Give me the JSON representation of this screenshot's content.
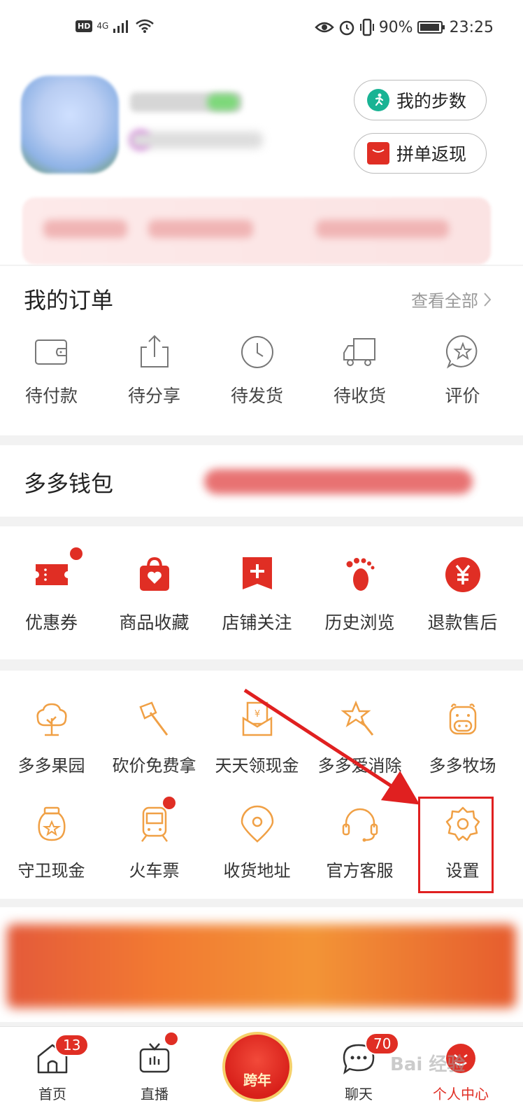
{
  "status_bar": {
    "hd": "HD",
    "net": "4G",
    "battery": "90%",
    "time": "23:25"
  },
  "header": {
    "steps_label": "我的步数",
    "group_label": "拼单返现"
  },
  "orders": {
    "title": "我的订单",
    "view_all": "查看全部",
    "items": [
      {
        "label": "待付款",
        "icon": "wallet-icon"
      },
      {
        "label": "待分享",
        "icon": "share-icon"
      },
      {
        "label": "待发货",
        "icon": "clock-icon"
      },
      {
        "label": "待收货",
        "icon": "truck-icon"
      },
      {
        "label": "评价",
        "icon": "star-bubble-icon"
      }
    ]
  },
  "wallet": {
    "title": "多多钱包"
  },
  "services": [
    {
      "label": "优惠券",
      "icon": "coupon-icon"
    },
    {
      "label": "商品收藏",
      "icon": "favorite-bag-icon"
    },
    {
      "label": "店铺关注",
      "icon": "store-follow-icon"
    },
    {
      "label": "历史浏览",
      "icon": "footprint-icon"
    },
    {
      "label": "退款售后",
      "icon": "refund-icon"
    }
  ],
  "tools_row1": [
    {
      "label": "多多果园",
      "icon": "tree-icon"
    },
    {
      "label": "砍价免费拿",
      "icon": "axe-icon"
    },
    {
      "label": "天天领现金",
      "icon": "cash-envelope-icon"
    },
    {
      "label": "多多爱消除",
      "icon": "star-wand-icon"
    },
    {
      "label": "多多牧场",
      "icon": "cow-icon"
    }
  ],
  "tools_row2": [
    {
      "label": "守卫现金",
      "icon": "cash-jar-icon"
    },
    {
      "label": "火车票",
      "icon": "train-icon"
    },
    {
      "label": "收货地址",
      "icon": "location-icon"
    },
    {
      "label": "官方客服",
      "icon": "headset-icon"
    },
    {
      "label": "设置",
      "icon": "gear-icon"
    }
  ],
  "tabbar": {
    "home": {
      "label": "首页",
      "badge": "13"
    },
    "live": {
      "label": "直播"
    },
    "center": {
      "label": "跨年"
    },
    "chat": {
      "label": "聊天",
      "badge": "70"
    },
    "me": {
      "label": "个人中心"
    }
  },
  "watermark": "Bai 经验",
  "colors": {
    "brand_red": "#e02e24",
    "tool_orange": "#f0a045",
    "steps_green": "#19b394"
  }
}
